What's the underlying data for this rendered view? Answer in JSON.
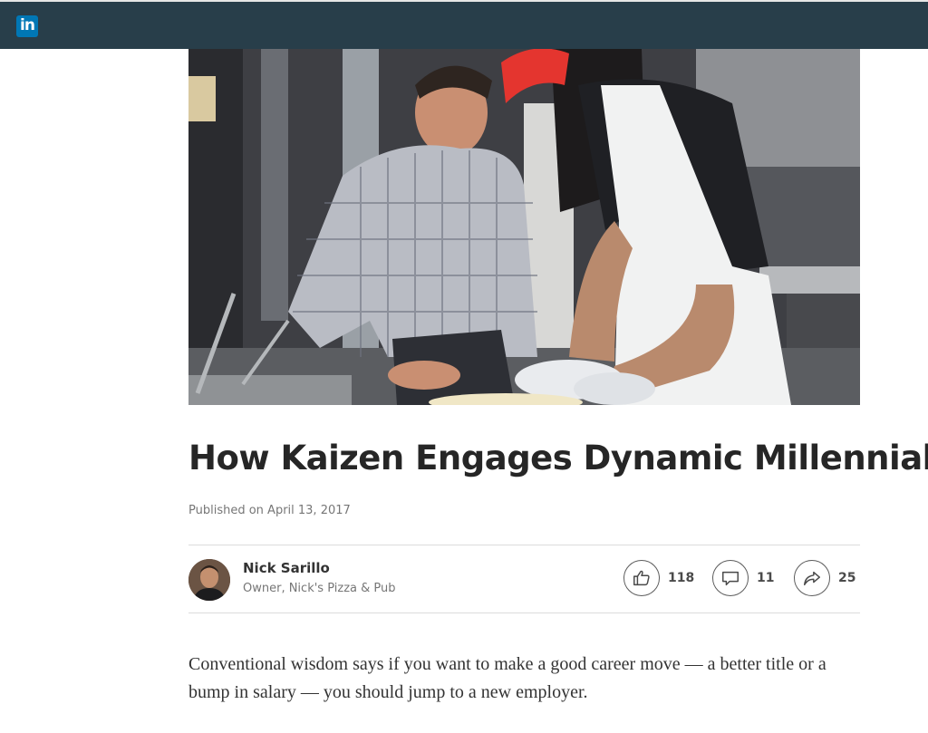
{
  "header": {
    "logo_text": "in",
    "logo_color": "#0077b5",
    "bar_color": "#283e4a"
  },
  "article": {
    "hero_image_alt": "Man in plaid shirt and employee in red cap and apron preparing pizza dough",
    "title": "How Kaizen Engages Dynamic Millennials",
    "published": "Published on April 13, 2017",
    "author": {
      "name": "Nick Sarillo",
      "role": "Owner, Nick's Pizza & Pub"
    },
    "actions": {
      "likes": "118",
      "comments": "11",
      "shares": "25"
    },
    "body": "Conventional wisdom says if you want to make a good career move — a better title or a bump in salary — you should jump to a new employer."
  }
}
